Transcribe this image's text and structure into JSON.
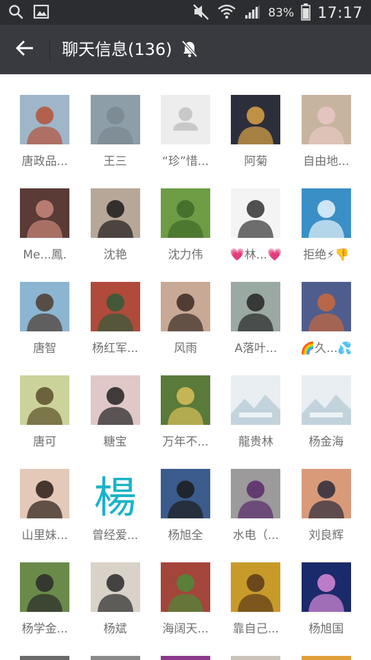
{
  "status_bar": {
    "battery_pct": "83%",
    "clock": "17:17",
    "icons": [
      "search-icon",
      "image-icon",
      "mute-icon",
      "wifi-icon",
      "signal-icon",
      "battery-icon"
    ]
  },
  "header": {
    "title": "聊天信息(136)",
    "back_icon": "back-arrow-icon",
    "mute_icon": "notifications-off-icon"
  },
  "members": [
    {
      "name": "唐政品...",
      "bg": "#9fb6c9",
      "fg": "#b5523a"
    },
    {
      "name": "王三",
      "bg": "#8e9ea8",
      "fg": "#7a8890"
    },
    {
      "name": "“珍”惜...",
      "bg": "#ededed",
      "fg": "#c8c8c8",
      "placeholder": true
    },
    {
      "name": "阿菊",
      "bg": "#2c2f3b",
      "fg": "#d9a247"
    },
    {
      "name": "自由地...",
      "bg": "#c7b49f",
      "fg": "#e8c7c3"
    },
    {
      "name": "Me...鳳.",
      "bg": "#5a3b35",
      "fg": "#c9877a"
    },
    {
      "name": "沈艳",
      "bg": "#b7a799",
      "fg": "#1c1a1a"
    },
    {
      "name": "沈力伟",
      "bg": "#6e9c45",
      "fg": "#3f6a28"
    },
    {
      "name": "💗林...💗",
      "bg": "#f4f4f4",
      "fg": "#333333"
    },
    {
      "name": "拒绝⚡👎",
      "bg": "#3a8fc6",
      "fg": "#e8f4fb"
    },
    {
      "name": "唐智",
      "bg": "#8bb5d1",
      "fg": "#4c3b2e"
    },
    {
      "name": "杨红军...",
      "bg": "#b04a3a",
      "fg": "#2f5b3a"
    },
    {
      "name": "风雨",
      "bg": "#c7a996",
      "fg": "#3b2c24"
    },
    {
      "name": "A落叶...",
      "bg": "#9aa9a1",
      "fg": "#262626"
    },
    {
      "name": "🌈久...💦",
      "bg": "#4f5d8e",
      "fg": "#c9683c"
    },
    {
      "name": "唐可",
      "bg": "#cbd39b",
      "fg": "#5a4f2a"
    },
    {
      "name": "糖宝",
      "bg": "#e0c8c8",
      "fg": "#222222"
    },
    {
      "name": "万年不...",
      "bg": "#5a7a3a",
      "fg": "#d8c05a"
    },
    {
      "name": "龍贵林",
      "bg": "#e8eef1",
      "fg": "#c3d3dc",
      "placeholder_img": true
    },
    {
      "name": "杨金海",
      "bg": "#e8eef1",
      "fg": "#c3d3dc",
      "placeholder_img": true
    },
    {
      "name": "山里妹...",
      "bg": "#e4c9b9",
      "fg": "#2a1c15"
    },
    {
      "name": "曾经爱...",
      "bg": "#ffffff",
      "fg": "#19b3c9",
      "glyph": "楊"
    },
    {
      "name": "杨旭全",
      "bg": "#3b5b8c",
      "fg": "#1c1c1c"
    },
    {
      "name": "水电（...",
      "bg": "#9c9a9a",
      "fg": "#5a2a6a"
    },
    {
      "name": "刘良辉",
      "bg": "#d99a7a",
      "fg": "#2a2a3a"
    },
    {
      "name": "杨学金...",
      "bg": "#6a8a4a",
      "fg": "#2a2a2a"
    },
    {
      "name": "杨斌",
      "bg": "#d9d2c8",
      "fg": "#2a2a2a"
    },
    {
      "name": "海阔天...",
      "bg": "#a3453a",
      "fg": "#4c8a3a"
    },
    {
      "name": "靠自己...",
      "bg": "#c89a2a",
      "fg": "#5a3a1a"
    },
    {
      "name": "杨旭国",
      "bg": "#1b2a6a",
      "fg": "#d88ad8"
    }
  ],
  "partial_row_colors": [
    "#6a6a6a",
    "#8a8a8a",
    "#8b3a8b",
    "#c9c3b9",
    "#e0a03a"
  ]
}
